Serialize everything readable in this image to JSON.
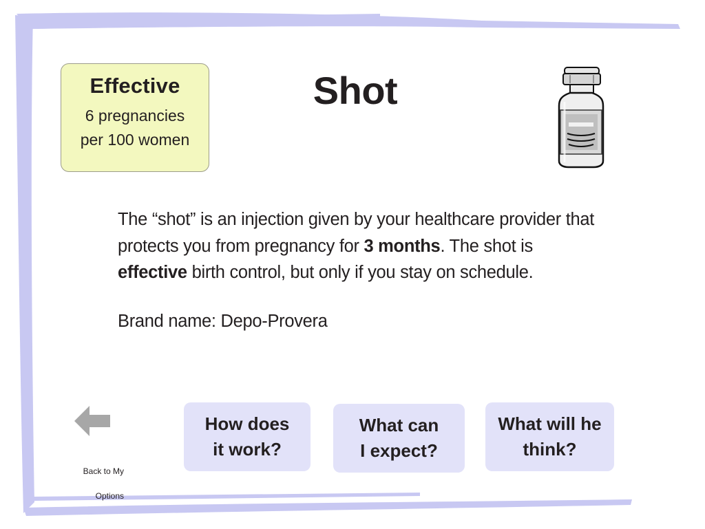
{
  "effective_box": {
    "title": "Effective",
    "line1": "6 pregnancies",
    "line2": "per 100 women"
  },
  "page": {
    "title": "Shot"
  },
  "icons": {
    "method": "vial-icon",
    "back": "left-arrow-icon"
  },
  "description": {
    "part1": "The “shot” is an injection given by your healthcare provider that protects you from pregnancy for ",
    "bold1": "3 months",
    "part2": ". The shot is ",
    "bold2": "effective",
    "part3": " birth control, but only if you stay on schedule."
  },
  "brand": {
    "text": "Brand name: Depo-Provera"
  },
  "back_button": {
    "line1": "Back to My",
    "line2": "Options"
  },
  "nav_buttons": [
    {
      "line1": "How does",
      "line2": "it work?"
    },
    {
      "line1": "What can",
      "line2": "I expect?"
    },
    {
      "line1": "What will he",
      "line2": "think?"
    }
  ],
  "colors": {
    "frame": "#c8c8f2",
    "effective_bg": "#f3f8bf",
    "button_bg": "#e2e2f9",
    "arrow": "#a7a7a7",
    "text": "#231f20"
  }
}
